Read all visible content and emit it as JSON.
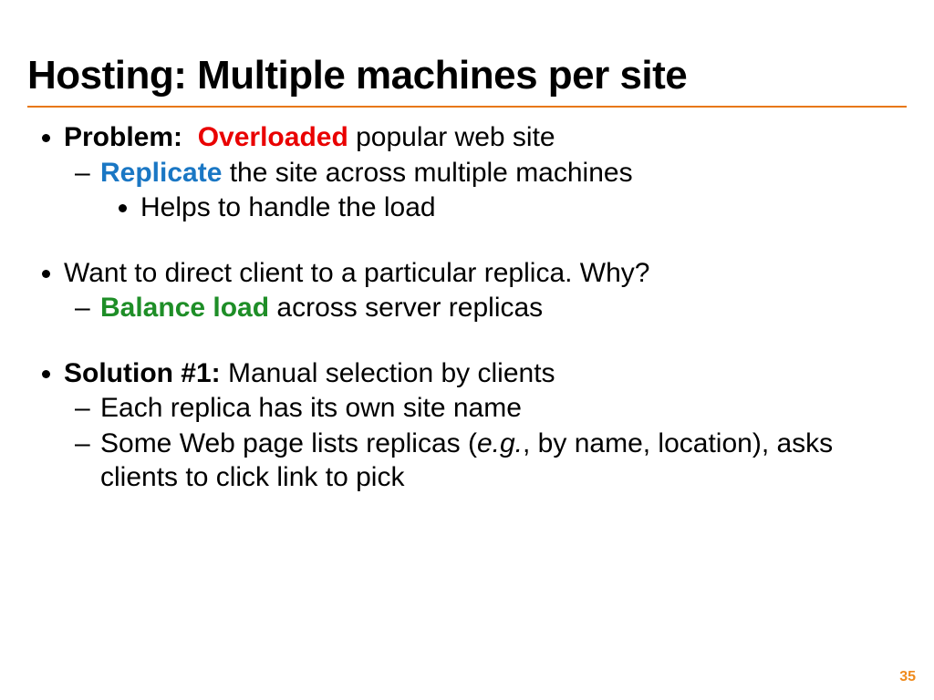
{
  "title": "Hosting: Multiple machines per site",
  "b1": {
    "label": "Problem:",
    "highlight": "Overloaded",
    "rest": " popular web site",
    "sub_highlight": "Replicate",
    "sub_rest": " the site across multiple machines",
    "subsub": "Helps to handle the load"
  },
  "b2": {
    "text": "Want to direct client to a particular replica.  Why?",
    "sub_highlight": "Balance load",
    "sub_rest": " across server replicas"
  },
  "b3": {
    "label": "Solution #1:",
    "rest": " Manual selection by clients",
    "sub1": "Each replica has its own site name",
    "sub2_a": "Some Web page lists replicas (",
    "sub2_eg": "e.g.",
    "sub2_b": ", by name, location), asks clients to click link to pick"
  },
  "page": "35"
}
